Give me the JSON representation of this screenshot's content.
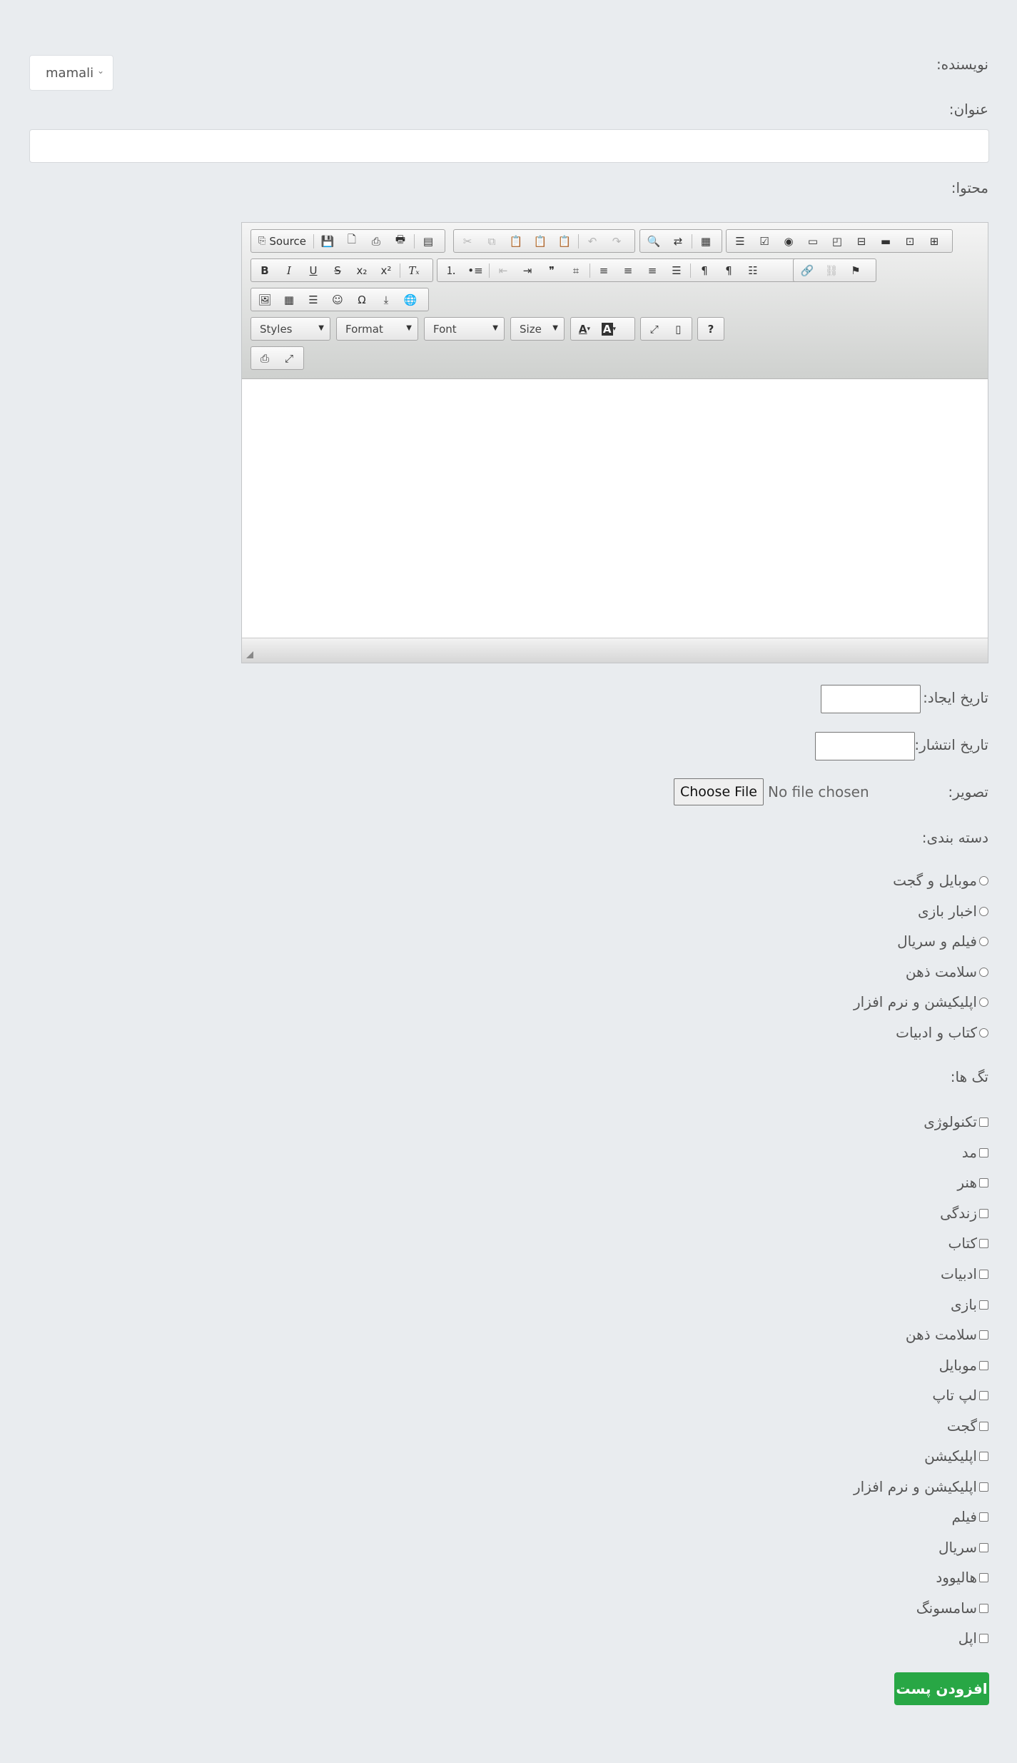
{
  "form": {
    "author_label": "نویسنده:",
    "author_value": "mamali",
    "title_label": "عنوان:",
    "content_label": "محتوا:",
    "created_label": "تاریخ ایجاد:",
    "published_label": "تاریخ انتشار:",
    "image_label": "تصویر:",
    "file_button": "Choose File",
    "file_status": "No file chosen",
    "category_label": "دسته بندی:",
    "tags_label": "تگ ها:",
    "submit_label": "افزودن پست"
  },
  "editor": {
    "source_label": "Source",
    "styles": "Styles",
    "format": "Format",
    "font": "Font",
    "size": "Size",
    "help": "?"
  },
  "categories": [
    "موبایل و گجت",
    "اخبار بازی",
    "فیلم و سریال",
    "سلامت ذهن",
    "اپلیکیشن و نرم افزار",
    "کتاب و ادبیات"
  ],
  "tags": [
    "تکنولوژی",
    "مد",
    "هنر",
    "زندگی",
    "کتاب",
    "ادبیات",
    "بازی",
    "سلامت ذهن",
    "موبایل",
    "لپ تاپ",
    "گجت",
    "اپلیکیشن",
    "اپلیکیشن و نرم افزار",
    "فیلم",
    "سریال",
    "هالیوود",
    "سامسونگ",
    "اپل"
  ],
  "colors": {
    "submit_bg": "#28a745",
    "page_bg": "#e9ecef"
  }
}
